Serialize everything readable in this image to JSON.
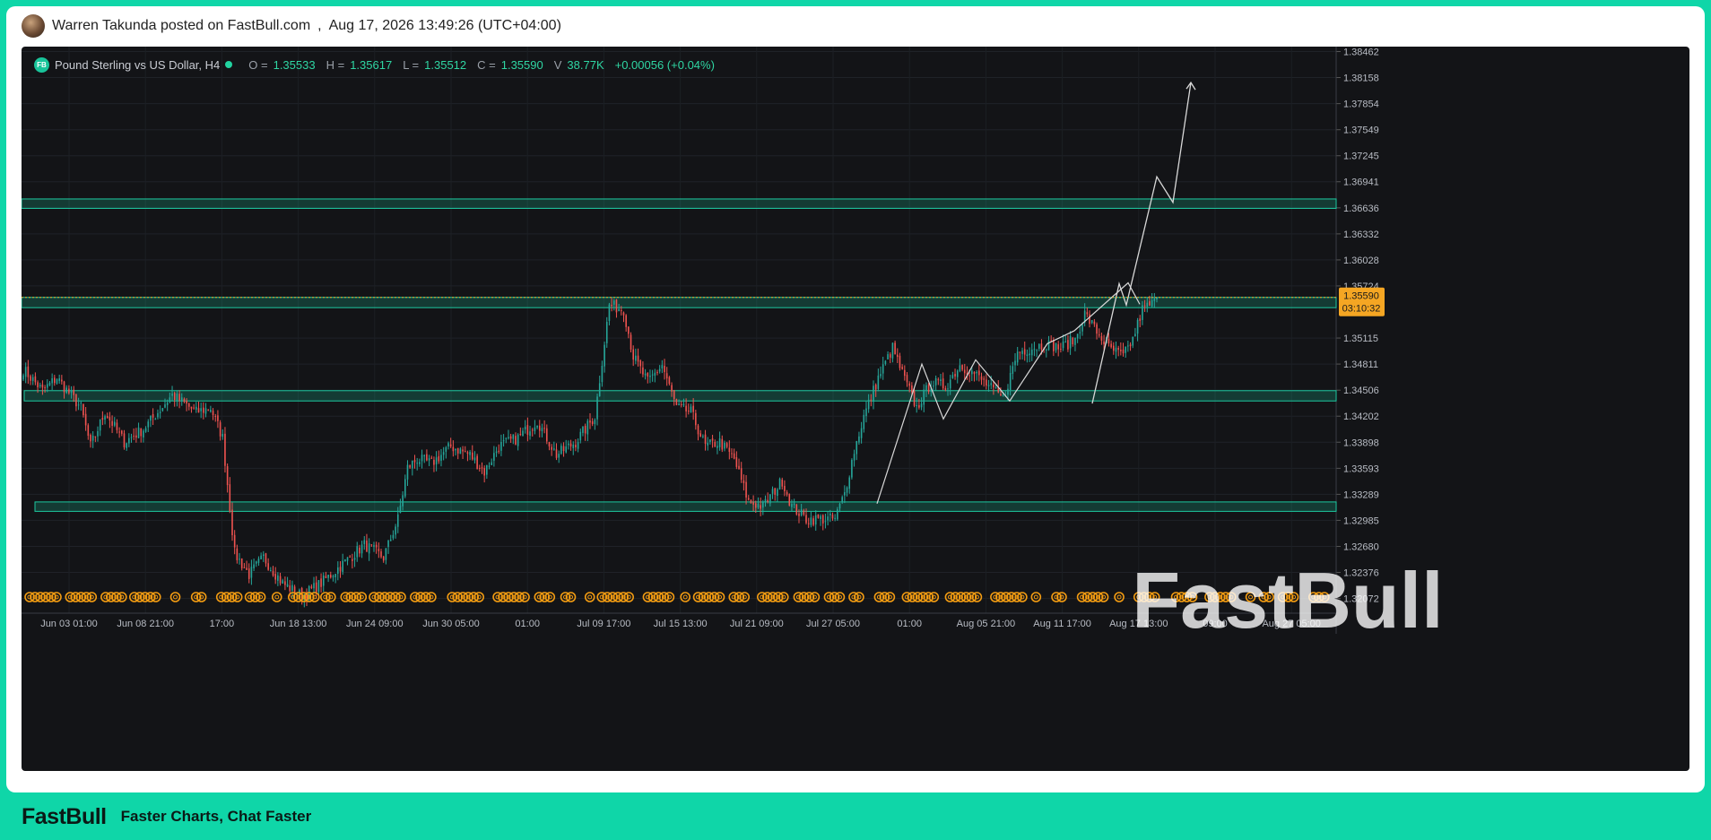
{
  "post": {
    "author_line": "Warren Takunda posted on FastBull.com",
    "separator": ",",
    "timestamp": "Aug 17, 2026 13:49:26 (UTC+04:00)"
  },
  "legend": {
    "badge": "FB",
    "symbol": "Pound Sterling vs US Dollar, H4",
    "o_label": "O =",
    "o_value": "1.35533",
    "h_label": "H =",
    "h_value": "1.35617",
    "l_label": "L =",
    "l_value": "1.35512",
    "c_label": "C =",
    "c_value": "1.35590",
    "v_label": "V",
    "v_value": "38.77K",
    "change": "+0.00056 (+0.04%)"
  },
  "price_tag": {
    "price": "1.35590",
    "countdown": "03:10:32"
  },
  "watermark": "FastBull",
  "footer": {
    "logo": "FastBull",
    "tagline": "Faster Charts, Chat Faster"
  },
  "colors": {
    "up": "#26a69a",
    "down": "#ef5350",
    "zone": "#1dc9a0",
    "price_tag": "#f5a623",
    "event_marker": "#f39c12",
    "projection": "#d8d8d8"
  },
  "chart_data": {
    "type": "candlestick",
    "symbol": "GBPUSD",
    "timeframe": "H4",
    "ylim": [
      1.319,
      1.3852
    ],
    "y_ticks": [
      "1.38462",
      "1.38158",
      "1.37854",
      "1.37549",
      "1.37245",
      "1.36941",
      "1.36636",
      "1.36332",
      "1.36028",
      "1.35724",
      "1.35115",
      "1.34811",
      "1.34506",
      "1.34202",
      "1.33898",
      "1.33593",
      "1.33289",
      "1.32985",
      "1.32680",
      "1.32376",
      "1.32072"
    ],
    "x_ticks": [
      "Jun 03 01:00",
      "Jun 08 21:00",
      "17:00",
      "Jun 18 13:00",
      "Jun 24 09:00",
      "Jun 30 05:00",
      "01:00",
      "Jul 09 17:00",
      "Jul 15 13:00",
      "Jul 21 09:00",
      "Jul 27 05:00",
      "01:00",
      "Aug 05 21:00",
      "Aug 11 17:00",
      "Aug 17 13:00",
      "09:00",
      "Aug 27 05:00"
    ],
    "last_price": 1.3559,
    "zones": [
      {
        "from": 1.3663,
        "to": 1.3674,
        "start": 0
      },
      {
        "from": 1.3547,
        "to": 1.3559,
        "start": 0
      },
      {
        "from": 1.3438,
        "to": 1.345,
        "start": 3
      },
      {
        "from": 1.3309,
        "to": 1.332,
        "start": 15
      }
    ],
    "anchors": [
      [
        0,
        1.3475
      ],
      [
        8,
        1.345
      ],
      [
        14,
        1.3465
      ],
      [
        24,
        1.343
      ],
      [
        28,
        1.3385
      ],
      [
        34,
        1.3425
      ],
      [
        42,
        1.339
      ],
      [
        50,
        1.3405
      ],
      [
        62,
        1.3445
      ],
      [
        72,
        1.3425
      ],
      [
        78,
        1.343
      ],
      [
        83,
        1.3395
      ],
      [
        88,
        1.326
      ],
      [
        94,
        1.3235
      ],
      [
        100,
        1.3255
      ],
      [
        108,
        1.3225
      ],
      [
        116,
        1.321
      ],
      [
        124,
        1.3225
      ],
      [
        134,
        1.325
      ],
      [
        142,
        1.327
      ],
      [
        150,
        1.3255
      ],
      [
        156,
        1.33
      ],
      [
        160,
        1.336
      ],
      [
        164,
        1.337
      ],
      [
        170,
        1.3365
      ],
      [
        178,
        1.3385
      ],
      [
        186,
        1.3375
      ],
      [
        192,
        1.3355
      ],
      [
        198,
        1.3385
      ],
      [
        206,
        1.3395
      ],
      [
        214,
        1.3415
      ],
      [
        222,
        1.3375
      ],
      [
        230,
        1.339
      ],
      [
        238,
        1.342
      ],
      [
        244,
        1.355
      ],
      [
        250,
        1.3545
      ],
      [
        254,
        1.349
      ],
      [
        260,
        1.346
      ],
      [
        266,
        1.348
      ],
      [
        272,
        1.343
      ],
      [
        278,
        1.3425
      ],
      [
        284,
        1.3385
      ],
      [
        290,
        1.339
      ],
      [
        296,
        1.337
      ],
      [
        302,
        1.332
      ],
      [
        308,
        1.3315
      ],
      [
        312,
        1.333
      ],
      [
        316,
        1.3345
      ],
      [
        320,
        1.3315
      ],
      [
        326,
        1.33
      ],
      [
        332,
        1.33
      ],
      [
        338,
        1.33
      ],
      [
        342,
        1.333
      ],
      [
        346,
        1.338
      ],
      [
        350,
        1.342
      ],
      [
        356,
        1.3465
      ],
      [
        362,
        1.35
      ],
      [
        366,
        1.347
      ],
      [
        372,
        1.343
      ],
      [
        378,
        1.346
      ],
      [
        384,
        1.3455
      ],
      [
        390,
        1.348
      ],
      [
        396,
        1.347
      ],
      [
        402,
        1.3455
      ],
      [
        408,
        1.344
      ],
      [
        414,
        1.3495
      ],
      [
        420,
        1.35
      ],
      [
        426,
        1.3505
      ],
      [
        432,
        1.35
      ],
      [
        438,
        1.351
      ],
      [
        442,
        1.354
      ],
      [
        448,
        1.3515
      ],
      [
        452,
        1.35
      ],
      [
        458,
        1.349
      ],
      [
        462,
        1.351
      ],
      [
        466,
        1.3545
      ],
      [
        472,
        1.3555
      ]
    ],
    "projection": [
      [
        1218,
        1.3435
      ],
      [
        1248,
        1.3575
      ],
      [
        1256,
        1.355
      ],
      [
        1290,
        1.37
      ],
      [
        1308,
        1.367
      ],
      [
        1328,
        1.381
      ]
    ],
    "wedge": [
      [
        978,
        1.3318
      ],
      [
        1028,
        1.3481
      ],
      [
        1052,
        1.3417
      ],
      [
        1088,
        1.3486
      ],
      [
        1126,
        1.3438
      ],
      [
        1168,
        1.3505
      ],
      [
        1198,
        1.352
      ],
      [
        1258,
        1.3576
      ],
      [
        1271,
        1.3551
      ]
    ]
  }
}
